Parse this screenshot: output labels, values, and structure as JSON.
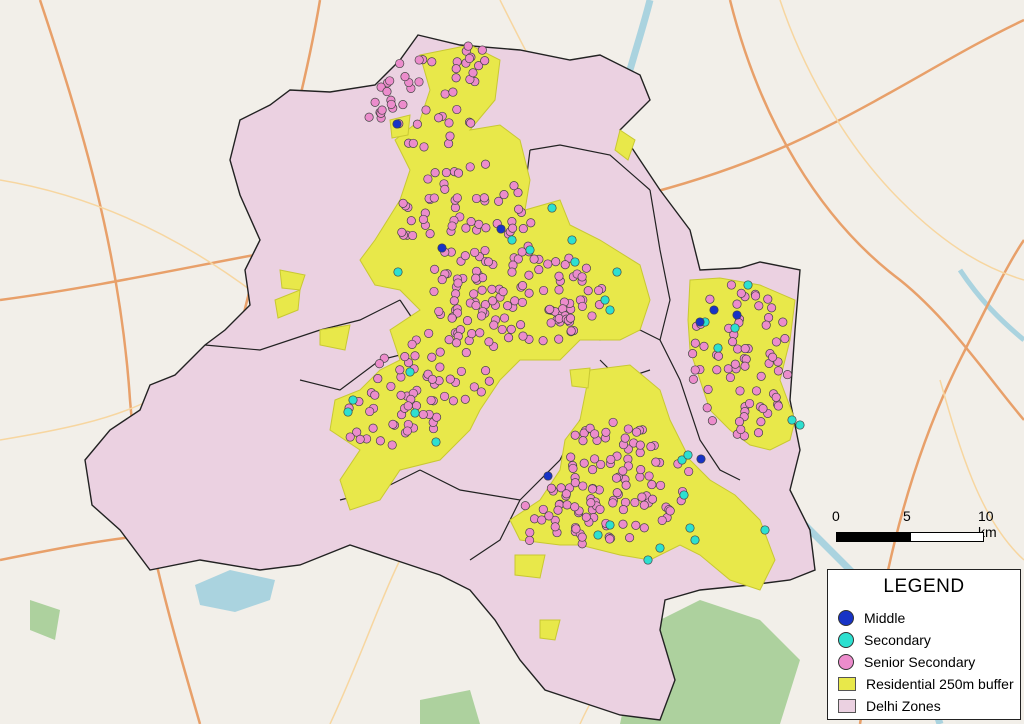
{
  "legend": {
    "title": "LEGEND",
    "items": [
      {
        "label": "Middle",
        "color": "#1733c6",
        "symbol": "circle"
      },
      {
        "label": "Secondary",
        "color": "#2de0d0",
        "symbol": "circle"
      },
      {
        "label": "Senior Secondary",
        "color": "#ec8ccc",
        "symbol": "circle"
      },
      {
        "label": "Residential 250m buffer",
        "color": "#e8e84a",
        "symbol": "fill-hatched"
      },
      {
        "label": "Delhi Zones",
        "color": "#ebd1e1",
        "symbol": "fill"
      }
    ]
  },
  "scale": {
    "labels": [
      "0",
      "5",
      "10 km"
    ]
  },
  "colors": {
    "basemap": "#f2efe9",
    "zone_fill": "#ebd1e1",
    "zone_border": "#222222",
    "buffer": "#e8e84a",
    "water": "#aad3df",
    "forest": "#add19e",
    "major_road": "#e8a06a"
  }
}
